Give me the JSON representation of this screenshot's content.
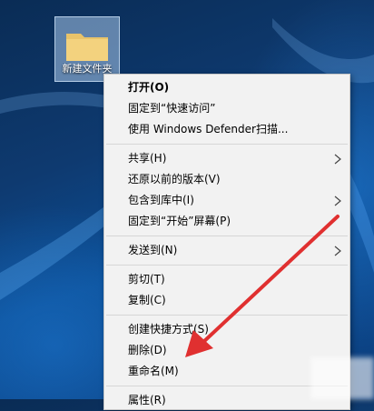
{
  "desktop": {
    "folder_label": "新建文件夹"
  },
  "menu": {
    "items": [
      {
        "label": "打开(O)",
        "bold": true
      },
      {
        "label": "固定到“快速访问”"
      },
      {
        "label": "使用 Windows Defender扫描..."
      },
      {
        "label": "共享(H)",
        "submenu": true
      },
      {
        "label": "还原以前的版本(V)"
      },
      {
        "label": "包含到库中(I)",
        "submenu": true
      },
      {
        "label": "固定到“开始”屏幕(P)"
      },
      {
        "label": "发送到(N)",
        "submenu": true
      },
      {
        "label": "剪切(T)"
      },
      {
        "label": "复制(C)"
      },
      {
        "label": "创建快捷方式(S)"
      },
      {
        "label": "删除(D)"
      },
      {
        "label": "重命名(M)"
      },
      {
        "label": "属性(R)"
      }
    ]
  },
  "colors": {
    "menu_bg": "#f2f2f2",
    "annotation_arrow": "#e03030"
  },
  "icons": {
    "folder": "folder-icon",
    "submenu": "chevron-right-icon"
  }
}
